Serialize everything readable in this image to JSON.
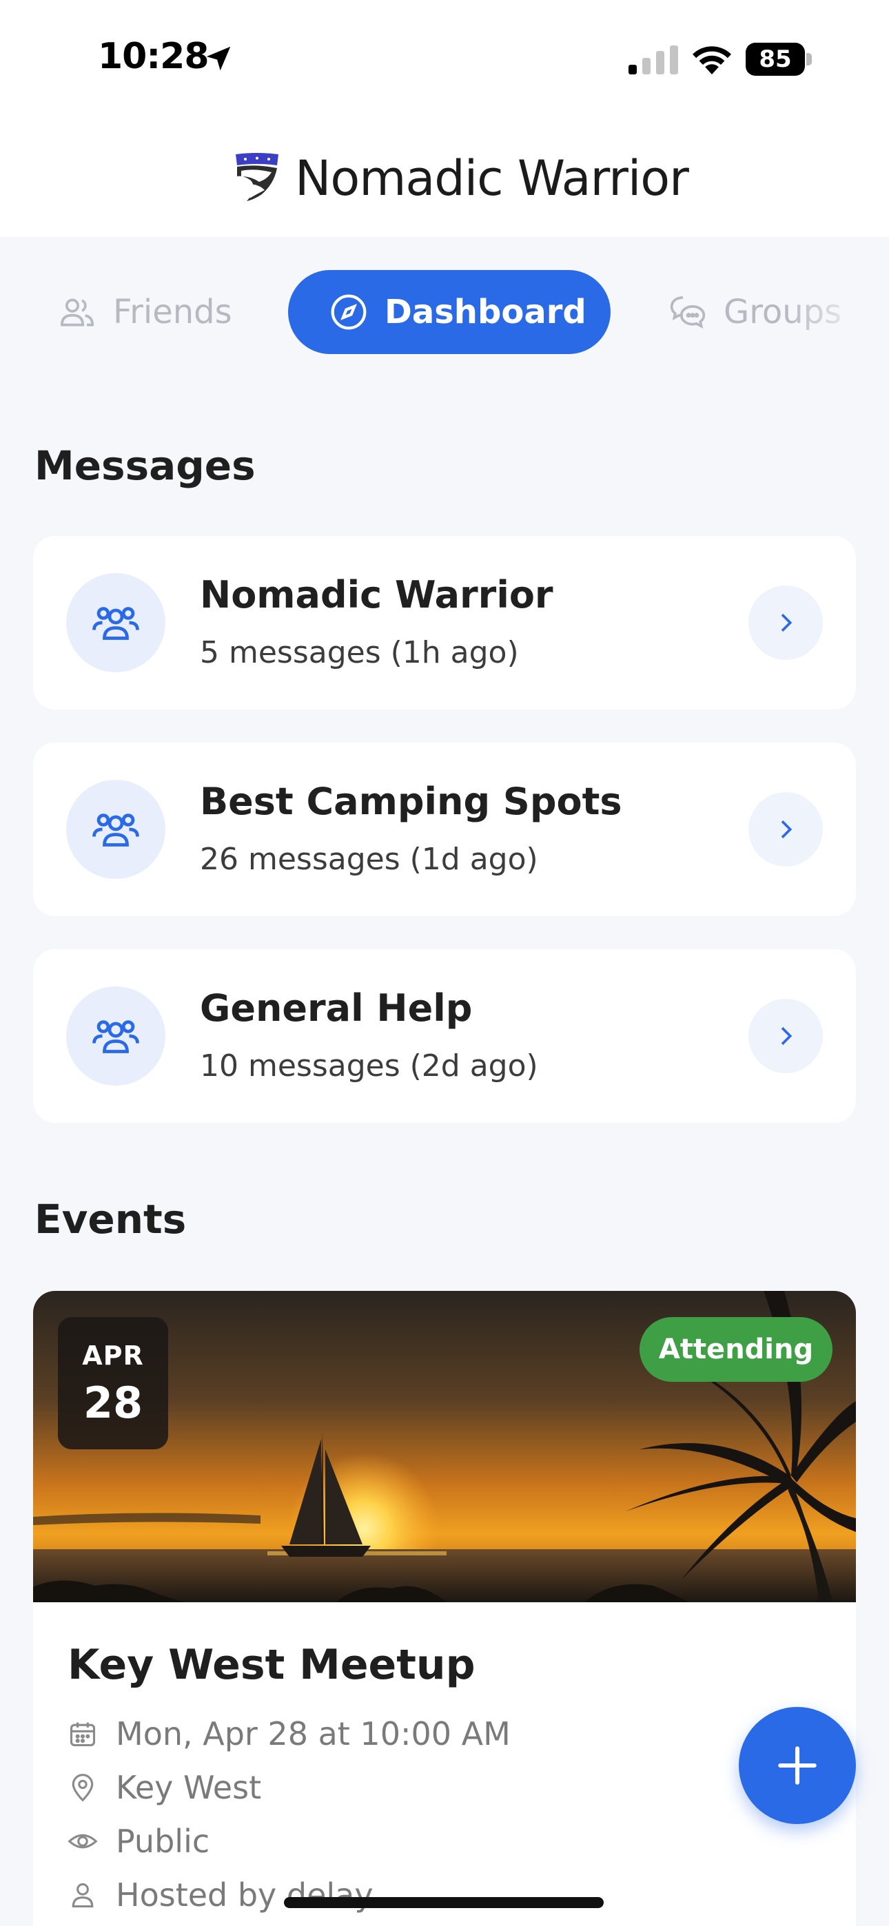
{
  "status_bar": {
    "time": "10:28",
    "battery": "85"
  },
  "app_bar": {
    "title": "Nomadic Warrior"
  },
  "tabs": [
    {
      "label": "Friends",
      "icon": "users-icon",
      "active": false
    },
    {
      "label": "Dashboard",
      "icon": "compass-icon",
      "active": true
    },
    {
      "label": "Groups",
      "icon": "chat-bubbles-icon",
      "active": false
    }
  ],
  "messages": {
    "title": "Messages",
    "items": [
      {
        "name": "Nomadic Warrior",
        "meta": "5 messages (1h ago)"
      },
      {
        "name": "Best Camping Spots",
        "meta": "26 messages (1d ago)"
      },
      {
        "name": "General Help",
        "meta": "10 messages (2d ago)"
      }
    ]
  },
  "events": {
    "title": "Events",
    "items": [
      {
        "month": "APR",
        "day": "28",
        "status": "Attending",
        "title": "Key West Meetup",
        "datetime": "Mon, Apr 28 at 10:00 AM",
        "location": "Key West",
        "visibility": "Public",
        "host": "Hosted by delay"
      }
    ]
  },
  "colors": {
    "accent": "#2b6ae6",
    "attending": "#3f9f45",
    "background": "#f6f7fb"
  }
}
